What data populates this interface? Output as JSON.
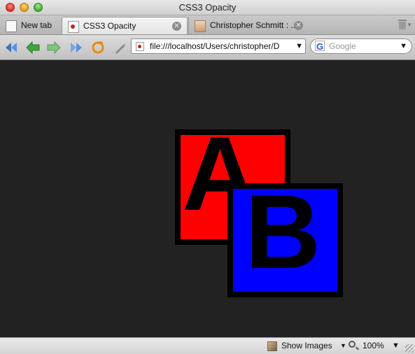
{
  "window": {
    "title": "CSS3 Opacity"
  },
  "tabs": [
    {
      "label": "New tab",
      "icon": "new-tab-icon"
    },
    {
      "label": "CSS3 Opacity",
      "icon": "page-icon",
      "active": true
    },
    {
      "label": "Christopher Schmitt : ...",
      "icon": "avatar-icon"
    }
  ],
  "toolbar": {
    "url": "file:///localhost/Users/christopher/D",
    "search_placeholder": "Google"
  },
  "content": {
    "box_a": {
      "letter": "A",
      "color": "#ff0000"
    },
    "box_b": {
      "letter": "B",
      "color": "#0000ff"
    },
    "background": "#222222"
  },
  "statusbar": {
    "show_images": "Show Images",
    "zoom": "100%"
  }
}
